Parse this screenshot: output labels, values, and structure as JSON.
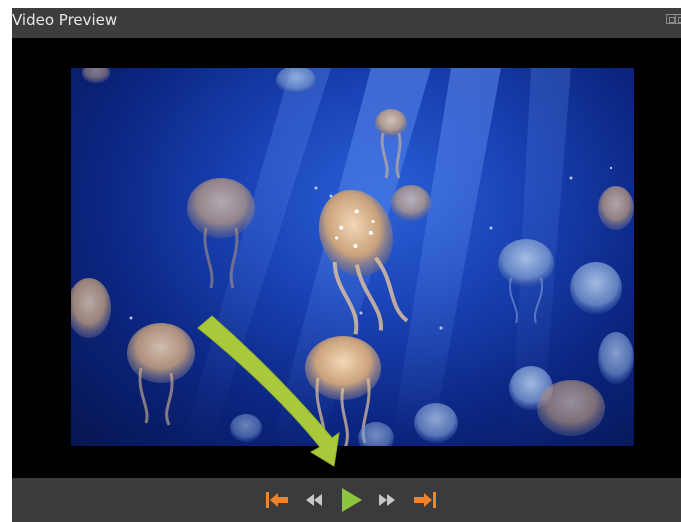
{
  "window": {
    "title": "Video Preview"
  },
  "icons": {
    "float": "float-panel-icon",
    "close": "close-panel-icon",
    "go_to_start": "skip-to-start-icon",
    "rewind": "rewind-icon",
    "play": "play-icon",
    "fast_forward": "fast-forward-icon",
    "go_to_end": "skip-to-end-icon"
  },
  "colors": {
    "titlebar": "#3d3d3d",
    "controls_bar": "#3b3b3b",
    "control_orange": "#f0832a",
    "control_gray": "#c8c8c8",
    "play_green": "#8cc63f",
    "annotation_arrow": "#a9c93a"
  }
}
